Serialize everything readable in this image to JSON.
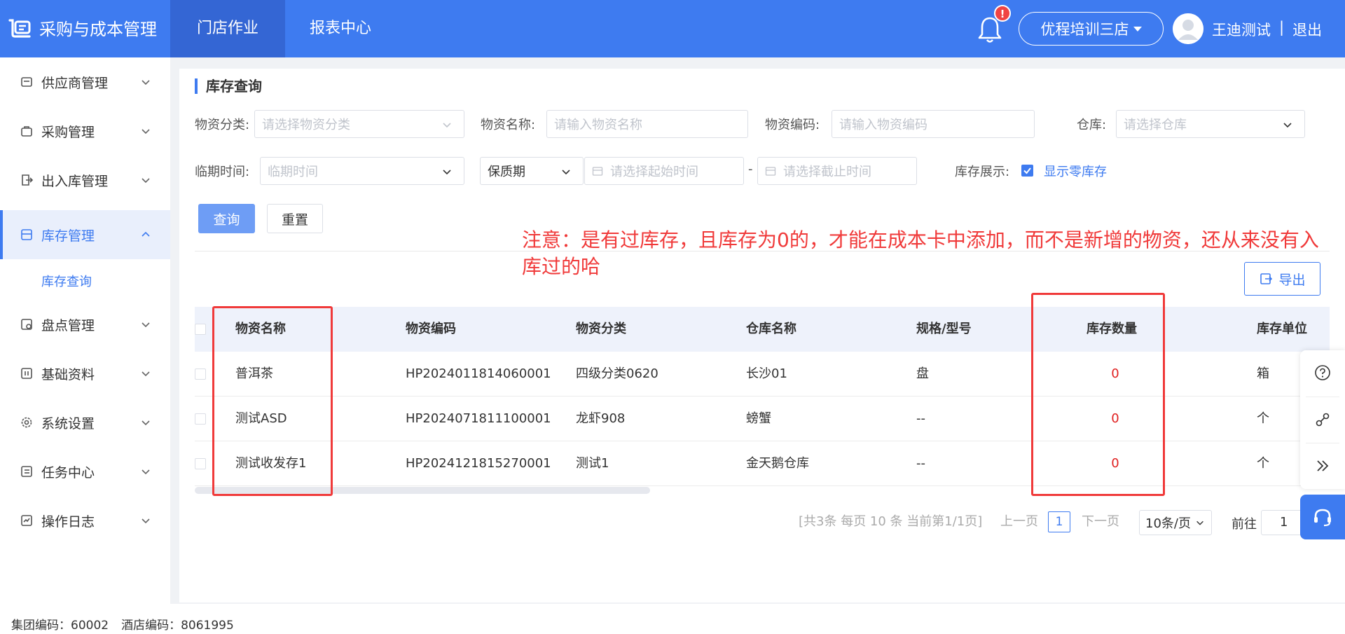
{
  "header": {
    "app_title": "采购与成本管理",
    "tabs": [
      "门店作业",
      "报表中心"
    ],
    "notification_badge": "!",
    "store": "优程培训三店",
    "user": "王迪测试",
    "separator": "|",
    "logout": "退出"
  },
  "sidebar": {
    "items": [
      {
        "label": "供应商管理",
        "icon": "supplier-icon"
      },
      {
        "label": "采购管理",
        "icon": "purchase-icon"
      },
      {
        "label": "出入库管理",
        "icon": "inout-icon"
      },
      {
        "label": "库存管理",
        "icon": "inventory-icon"
      },
      {
        "label": "盘点管理",
        "icon": "stocktake-icon"
      },
      {
        "label": "基础资料",
        "icon": "basic-data-icon"
      },
      {
        "label": "系统设置",
        "icon": "settings-icon"
      },
      {
        "label": "任务中心",
        "icon": "task-icon"
      },
      {
        "label": "操作日志",
        "icon": "log-icon"
      }
    ],
    "sub_item": "库存查询"
  },
  "page": {
    "title": "库存查询",
    "filters": {
      "category_label": "物资分类:",
      "category_placeholder": "请选择物资分类",
      "name_label": "物资名称:",
      "name_placeholder": "请输入物资名称",
      "code_label": "物资编码:",
      "code_placeholder": "请输入物资编码",
      "warehouse_label": "仓库:",
      "warehouse_placeholder": "请选择仓库",
      "expiry_label": "临期时间:",
      "expiry_placeholder": "临期时间",
      "period_type": "保质期",
      "start_placeholder": "请选择起始时间",
      "range_sep": "-",
      "end_placeholder": "请选择截止时间",
      "display_label": "库存展示:",
      "show_zero_label": "显示零库存",
      "show_zero_checked": true
    },
    "query_button": "查询",
    "reset_button": "重置",
    "annotation": "注意：是有过库存，且库存为0的，才能在成本卡中添加，而不是新增的物资，还从来没有入库过的哈",
    "export_button": "导出"
  },
  "table": {
    "columns": [
      "物资名称",
      "物资编码",
      "物资分类",
      "仓库名称",
      "规格/型号",
      "库存数量",
      "库存单位"
    ],
    "rows": [
      [
        "普洱茶",
        "HP2024011814060001",
        "四级分类0620",
        "长沙01",
        "盘",
        "0",
        "箱"
      ],
      [
        "测试ASD",
        "HP2024071811100001",
        "龙虾908",
        "螃蟹",
        "--",
        "0",
        "个"
      ],
      [
        "测试收发存1",
        "HP2024121815270001",
        "测试1",
        "金天鹅仓库",
        "--",
        "0",
        "个"
      ]
    ]
  },
  "pagination": {
    "summary": "[共3条 每页 10 条 当前第1/1页]",
    "prev": "上一页",
    "current": "1",
    "next": "下一页",
    "page_size": "10条/页",
    "goto_label": "前往",
    "goto_value": "1"
  },
  "footer": {
    "group_code": "集团编码：60002",
    "hotel_code": "酒店编码：8061995"
  },
  "colors": {
    "primary": "#3e7bf0",
    "annotation_red": "#f03a3a",
    "zero_stock_red": "#e02020"
  }
}
